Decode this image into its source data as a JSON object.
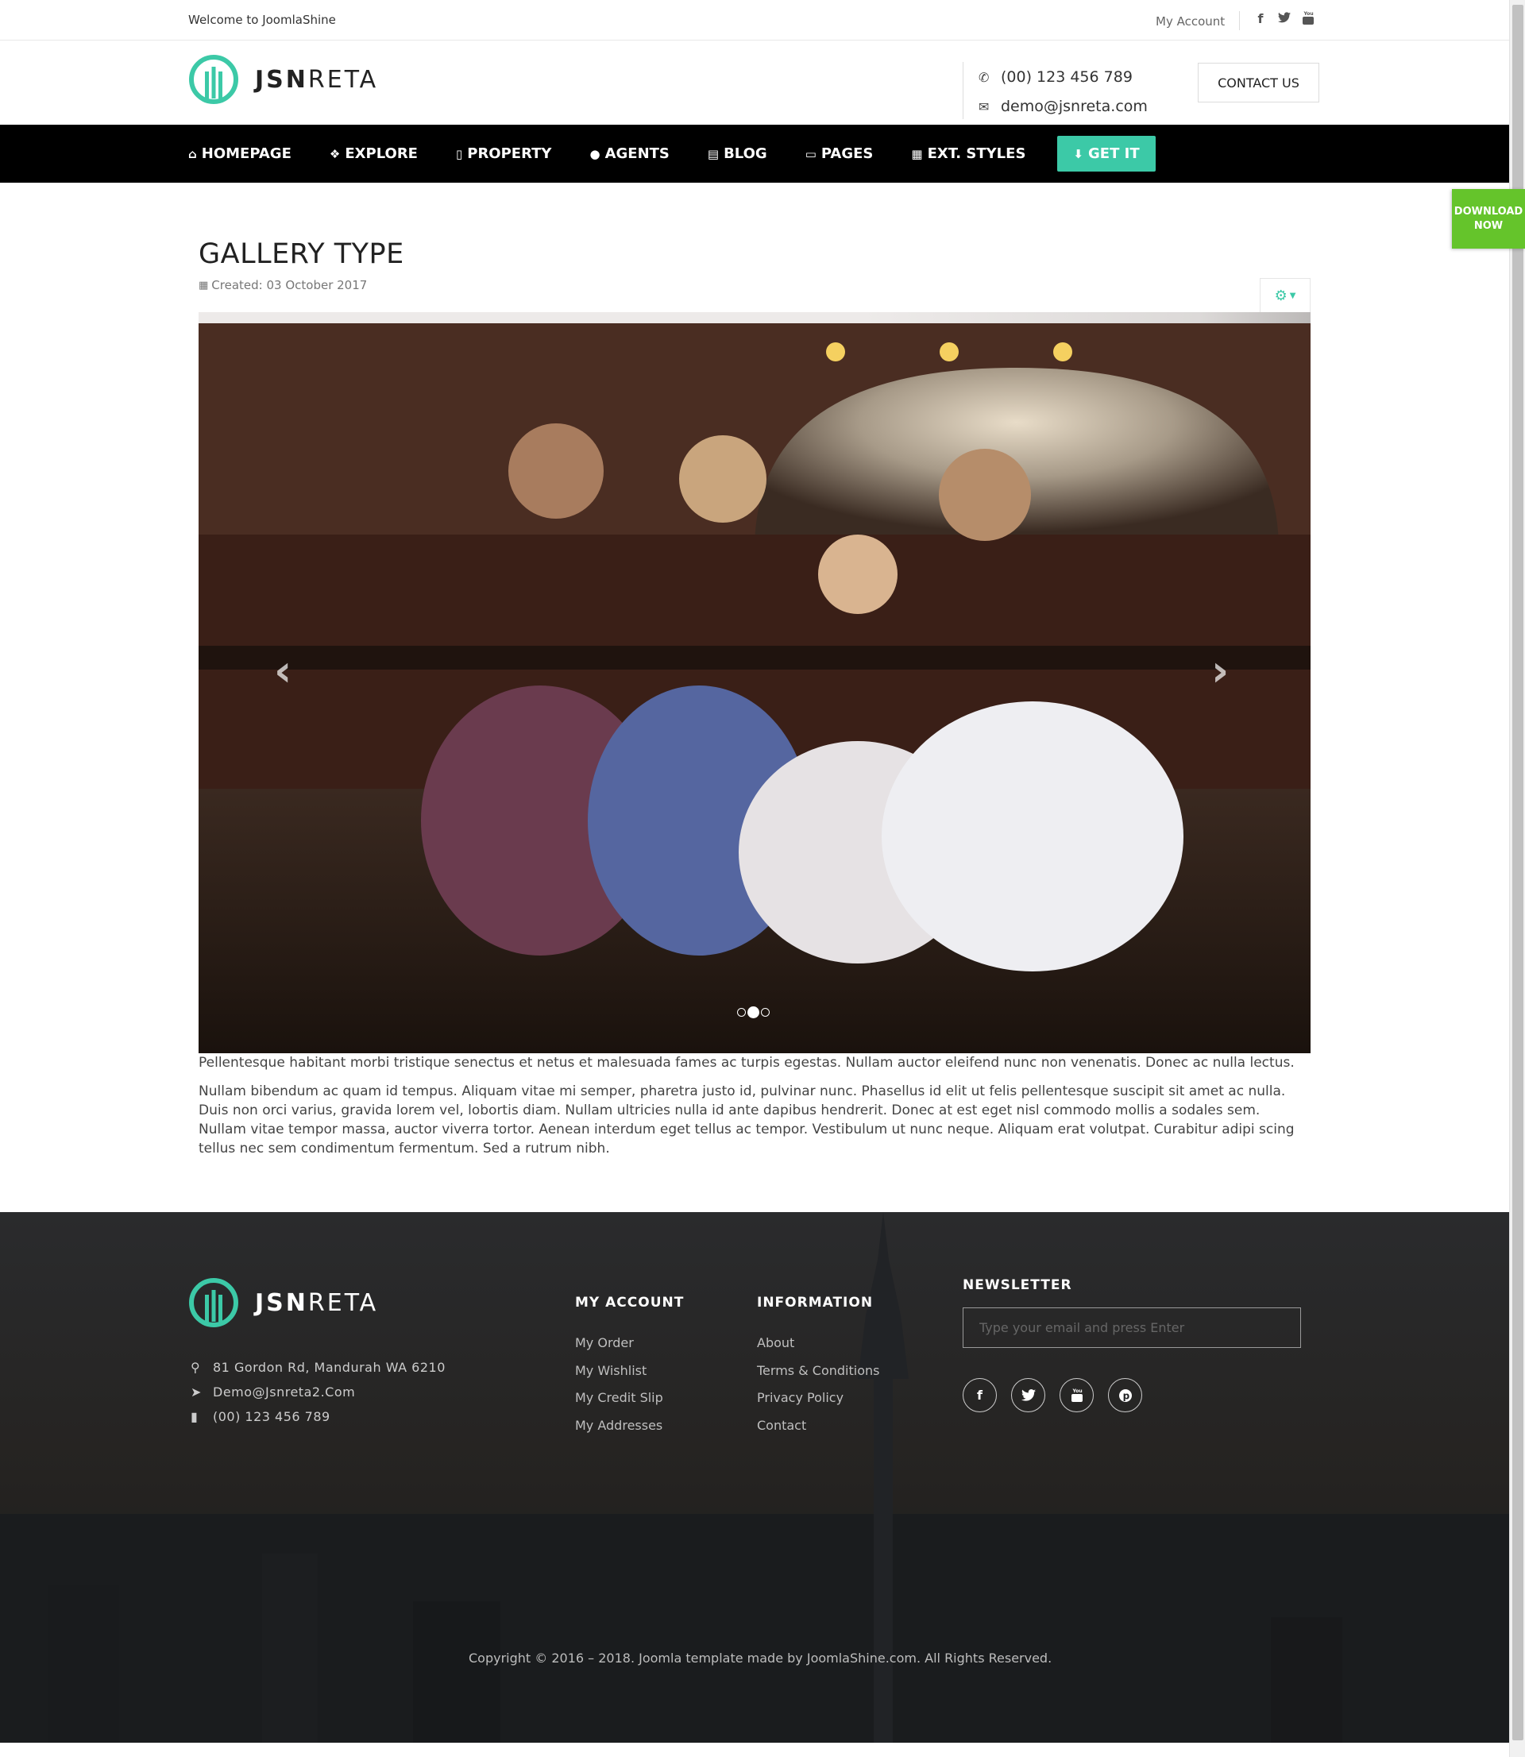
{
  "topbar": {
    "welcome": "Welcome to JoomlaShine",
    "account_link": "My Account",
    "social": [
      "facebook-icon",
      "twitter-icon",
      "youtube-icon"
    ]
  },
  "header": {
    "logo_bold": "JSN",
    "logo_light": "RETA",
    "phone": "(00) 123 456 789",
    "email": "demo@jsnreta.com",
    "contact_button": "CONTACT US"
  },
  "nav": {
    "items": [
      {
        "label": "HOMEPAGE",
        "icon": "home-icon"
      },
      {
        "label": "EXPLORE",
        "icon": "cubes-icon"
      },
      {
        "label": "PROPERTY",
        "icon": "building-icon"
      },
      {
        "label": "AGENTS",
        "icon": "user-icon"
      },
      {
        "label": "BLOG",
        "icon": "newspaper-icon"
      },
      {
        "label": "PAGES",
        "icon": "file-icon"
      },
      {
        "label": "EXT. STYLES",
        "icon": "qrcode-icon"
      }
    ],
    "cta": {
      "label": "GET IT",
      "icon": "download-icon",
      "color": "#3cc9a7"
    }
  },
  "download_badge": {
    "line1": "DOWNLOAD",
    "line2": "NOW",
    "color": "#65c42b"
  },
  "article": {
    "title": "GALLERY TYPE",
    "created": "Created: 03 October 2017",
    "gallery": {
      "slides": 3,
      "active_slide": 2
    },
    "paragraphs": [
      "Pellentesque habitant morbi tristique senectus et netus et malesuada fames ac turpis egestas. Nullam auctor eleifend nunc non venenatis. Donec ac nulla lectus.",
      "Nullam bibendum ac quam id tempus. Aliquam vitae mi semper, pharetra justo id, pulvinar nunc. Phasellus id elit ut felis pellentesque suscipit sit amet ac nulla. Duis non orci varius, gravida lorem vel, lobortis diam. Nullam ultricies nulla id ante dapibus hendrerit. Donec at est eget nisl commodo mollis a sodales sem. Nullam vitae tempor massa, auctor viverra tortor. Aenean interdum eget tellus ac tempor. Vestibulum ut nunc neque. Aliquam erat volutpat. Curabitur adipi scing tellus nec sem condimentum fermentum. Sed a rutrum nibh."
    ]
  },
  "footer": {
    "logo_bold": "JSN",
    "logo_light": "RETA",
    "address": "81 Gordon Rd, Mandurah WA 6210",
    "email": "Demo@Jsnreta2.Com",
    "phone": "(00) 123 456 789",
    "my_account": {
      "title": "MY ACCOUNT",
      "links": [
        "My Order",
        "My Wishlist",
        "My Credit Slip",
        "My Addresses"
      ]
    },
    "information": {
      "title": "INFORMATION",
      "links": [
        "About",
        "Terms & Conditions",
        "Privacy Policy",
        "Contact"
      ]
    },
    "newsletter": {
      "title": "NEWSLETTER",
      "placeholder": "Type your email and press Enter",
      "social": [
        "facebook-icon",
        "twitter-icon",
        "youtube-icon",
        "pinterest-icon"
      ]
    },
    "copyright": "Copyright © 2016 – 2018. Joomla template made by JoomlaShine.com. All Rights Reserved."
  },
  "colors": {
    "accent": "#3cc9a7",
    "nav_bg": "#000000",
    "download": "#65c42b"
  }
}
